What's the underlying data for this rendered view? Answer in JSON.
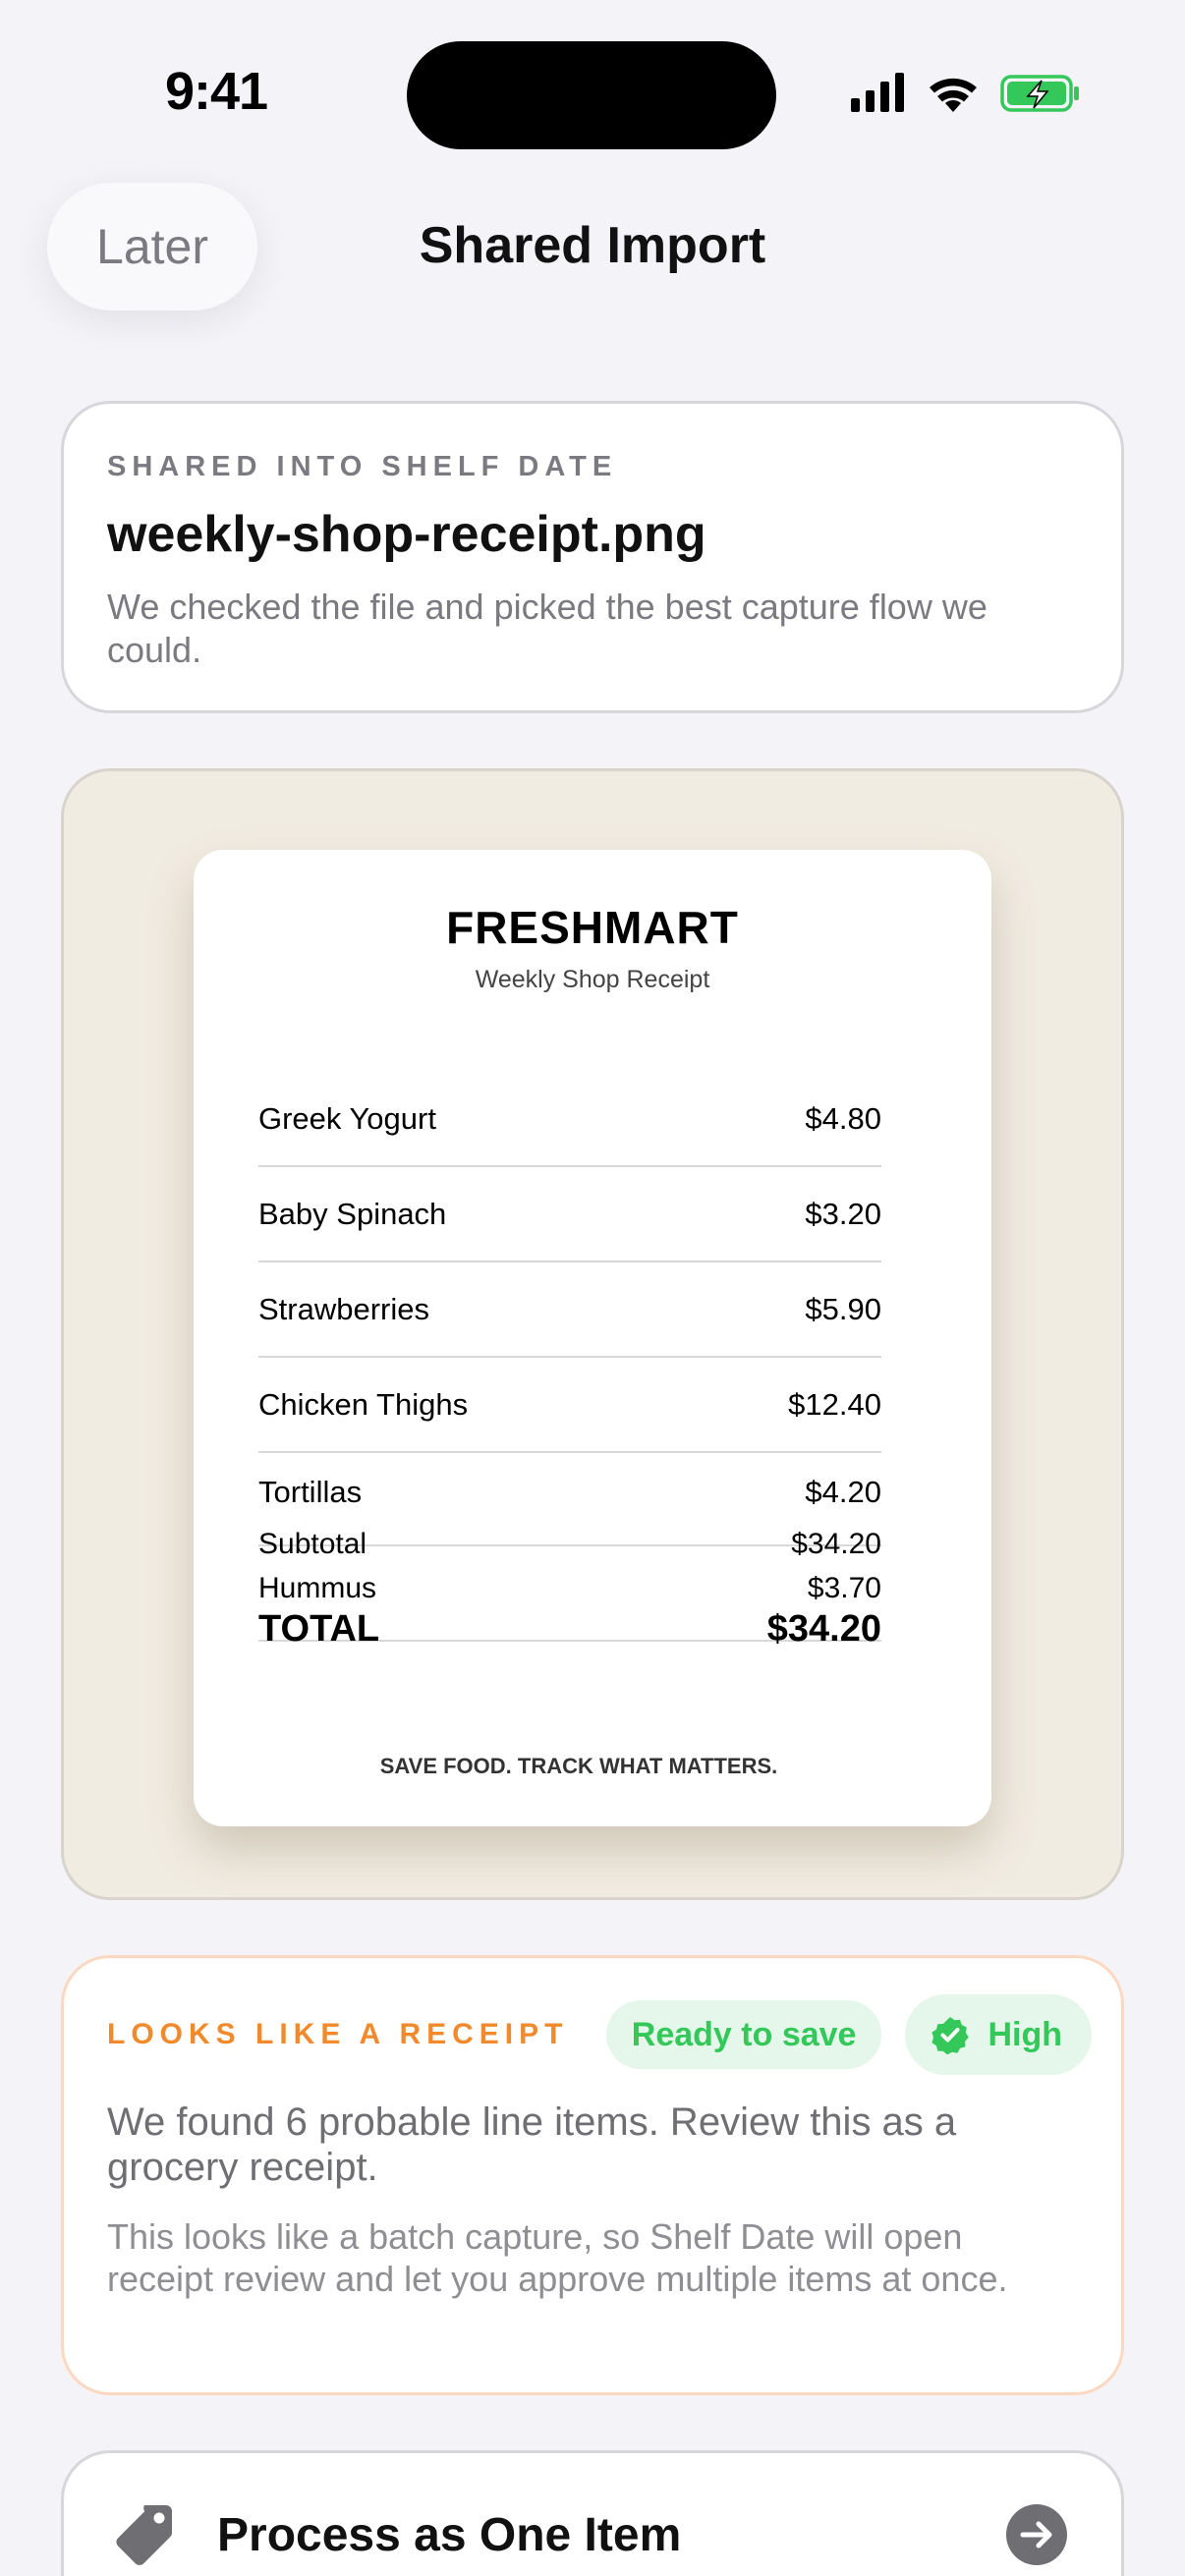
{
  "status": {
    "time": "9:41"
  },
  "nav": {
    "later": "Later",
    "title": "Shared Import"
  },
  "file_card": {
    "eyebrow": "SHARED INTO SHELF DATE",
    "file_name": "weekly-shop-receipt.png",
    "description": "We checked the file and picked the best capture flow we could."
  },
  "receipt": {
    "store": "FRESHMART",
    "subtitle": "Weekly Shop Receipt",
    "items": [
      {
        "name": "Greek Yogurt",
        "price": "$4.80"
      },
      {
        "name": "Baby Spinach",
        "price": "$3.20"
      },
      {
        "name": "Strawberries",
        "price": "$5.90"
      },
      {
        "name": "Chicken Thighs",
        "price": "$12.40"
      },
      {
        "name": "Tortillas",
        "price": "$4.20"
      }
    ],
    "subtotal_label": "Subtotal",
    "subtotal_value": "$34.20",
    "extra_item_name": "Hummus",
    "extra_item_price": "$3.70",
    "total_label": "TOTAL",
    "total_value": "$34.20",
    "footer": "SAVE FOOD. TRACK WHAT MATTERS."
  },
  "detection": {
    "label": "LOOKS LIKE A RECEIPT",
    "ready": "Ready to save",
    "confidence": "High",
    "main": "We found 6 probable line items. Review this as a grocery receipt.",
    "sub": "This looks like a batch capture, so Shelf Date will open receipt review and let you approve multiple items at once."
  },
  "action": {
    "label": "Process as One Item"
  },
  "colors": {
    "accent_orange": "#F08A2C",
    "success_green": "#34C759",
    "preview_bg": "#F1ECE2"
  }
}
